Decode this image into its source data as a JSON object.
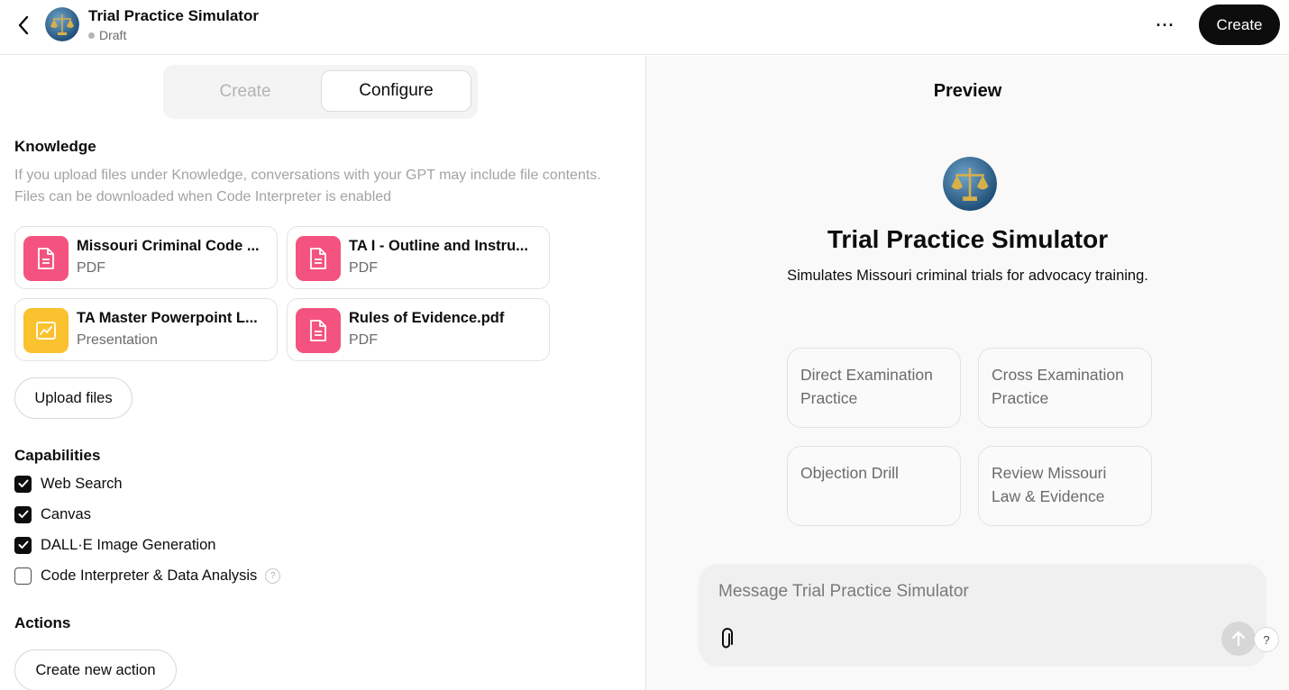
{
  "header": {
    "title": "Trial Practice Simulator",
    "status": "Draft",
    "create_label": "Create",
    "more_label": "···"
  },
  "tabs": {
    "create_label": "Create",
    "configure_label": "Configure"
  },
  "knowledge": {
    "heading": "Knowledge",
    "description": "If you upload files under Knowledge, conversations with your GPT may include file contents. Files can be downloaded when Code Interpreter is enabled",
    "files": [
      {
        "name": "Missouri Criminal Code ...",
        "type": "PDF",
        "icon": "document-icon",
        "color": "#f4537f"
      },
      {
        "name": "TA I - Outline and Instru...",
        "type": "PDF",
        "icon": "document-icon",
        "color": "#f4537f"
      },
      {
        "name": "TA Master Powerpoint L...",
        "type": "Presentation",
        "icon": "presentation-icon",
        "color": "#f9c22e"
      },
      {
        "name": "Rules of Evidence.pdf",
        "type": "PDF",
        "icon": "document-icon",
        "color": "#f4537f"
      }
    ],
    "upload_label": "Upload files"
  },
  "capabilities": {
    "heading": "Capabilities",
    "items": [
      {
        "label": "Web Search",
        "checked": true
      },
      {
        "label": "Canvas",
        "checked": true
      },
      {
        "label": "DALL·E Image Generation",
        "checked": true
      },
      {
        "label": "Code Interpreter & Data Analysis",
        "checked": false
      }
    ],
    "help_glyph": "?"
  },
  "actions": {
    "heading": "Actions",
    "create_label": "Create new action"
  },
  "preview": {
    "heading": "Preview",
    "title": "Trial Practice Simulator",
    "description": "Simulates Missouri criminal trials for advocacy training.",
    "starters": [
      "Direct Examination Practice",
      "Cross Examination Practice",
      "Objection Drill",
      "Review Missouri Law & Evidence"
    ],
    "composer_placeholder": "Message Trial Practice Simulator",
    "help_label": "?"
  },
  "colors": {
    "accent": "#0d0d0d",
    "pdf_icon": "#f4537f",
    "presentation_icon": "#f9c22e"
  }
}
